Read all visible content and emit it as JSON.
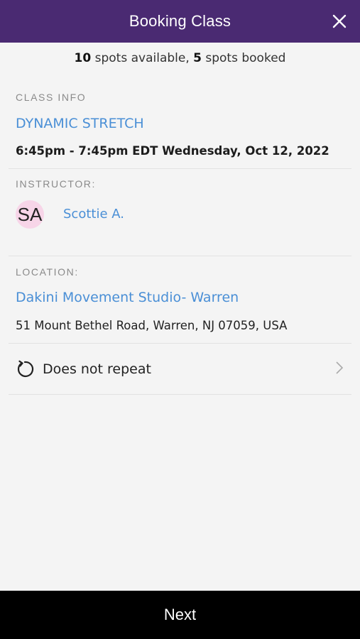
{
  "header": {
    "title": "Booking Class"
  },
  "spots": {
    "available_count": "10",
    "available_text": " spots available, ",
    "booked_count": "5",
    "booked_text": " spots booked"
  },
  "class_info": {
    "label": "CLASS INFO",
    "name": "DYNAMIC STRETCH",
    "time": "6:45pm - 7:45pm EDT Wednesday, Oct 12, 2022"
  },
  "instructor": {
    "label": "INSTRUCTOR:",
    "initials": "SA",
    "name": "Scottie A.",
    "avatar_color": "#f7d5e8"
  },
  "location": {
    "label": "LOCATION:",
    "name": "Dakini Movement Studio- Warren",
    "address": "51 Mount Bethel Road, Warren, NJ 07059, USA"
  },
  "repeat": {
    "icon": "repeat-icon",
    "label": "Does not repeat"
  },
  "footer": {
    "next_label": "Next"
  },
  "colors": {
    "header": "#4a2a72",
    "link": "#4a8fd6",
    "footer": "#000000",
    "background": "#f4f4f4"
  }
}
